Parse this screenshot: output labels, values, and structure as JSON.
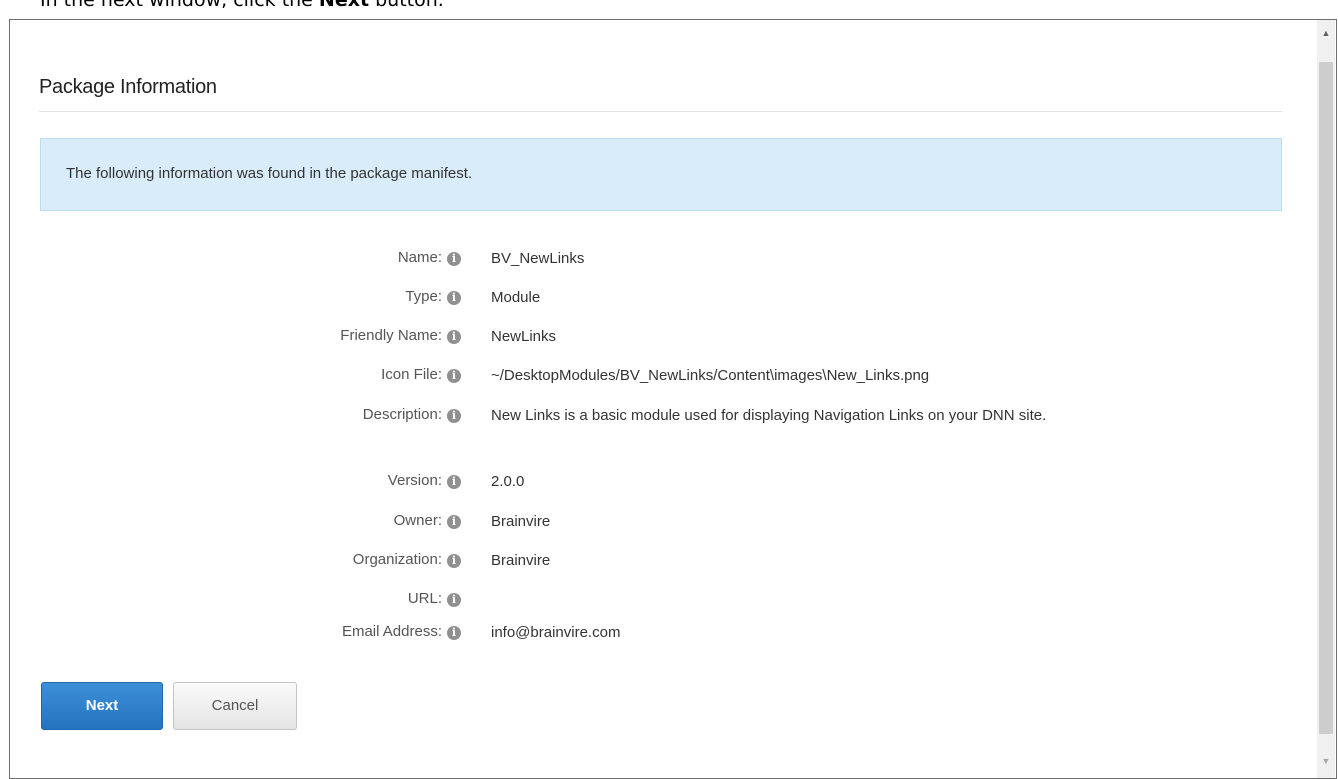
{
  "caption": {
    "prefix": "In the next window, click the ",
    "bold": "Next",
    "suffix": " button."
  },
  "section": {
    "title": "Package Information",
    "info_message": "The following information was found in the package manifest."
  },
  "fields": [
    {
      "label": "Name:",
      "value": "BV_NewLinks"
    },
    {
      "label": "Type:",
      "value": "Module"
    },
    {
      "label": "Friendly Name:",
      "value": "NewLinks"
    },
    {
      "label": "Icon File:",
      "value": "~/DesktopModules/BV_NewLinks/Content\\images\\New_Links.png"
    },
    {
      "label": "Description:",
      "value": "New Links is a basic module used for displaying Navigation Links on your DNN site."
    },
    {
      "label": "Version:",
      "value": "2.0.0"
    },
    {
      "label": "Owner:",
      "value": "Brainvire"
    },
    {
      "label": "Organization:",
      "value": "Brainvire"
    },
    {
      "label": "URL:",
      "value": ""
    },
    {
      "label": "Email Address:",
      "value": "info@brainvire.com"
    }
  ],
  "buttons": {
    "next": "Next",
    "cancel": "Cancel"
  },
  "icons": {
    "field_help": "info-icon",
    "scroll_up": "triangle-up-icon",
    "scroll_down": "triangle-down-icon"
  },
  "colors": {
    "info_box_bg": "#d8ecf9",
    "primary_button": "#2c7fc9"
  }
}
